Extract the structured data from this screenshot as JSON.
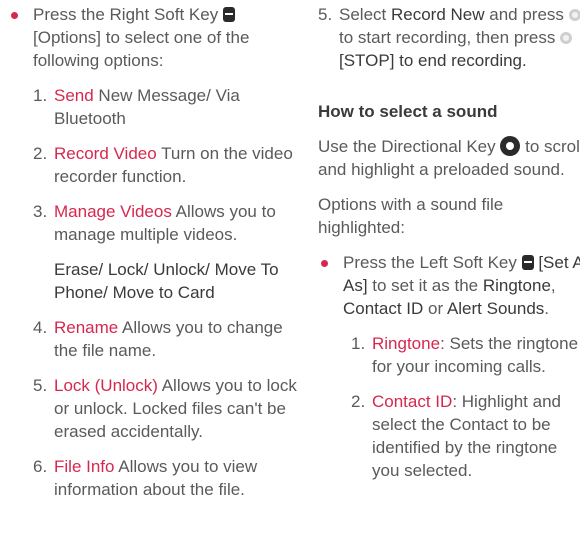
{
  "left": {
    "bullet": {
      "pre": "Press the Right Soft Key ",
      "post": "[Options] to select one of the following options:"
    },
    "items": [
      {
        "num": "1.",
        "title": "Send",
        "desc": " New Message/ Via Bluetooth"
      },
      {
        "num": "2.",
        "title": "Record Video",
        "desc": " Turn on the video recorder function."
      },
      {
        "num": "3.",
        "title": "Manage Videos",
        "desc": " Allows you to manage multiple videos."
      },
      {
        "num": "4.",
        "title": "Rename",
        "desc": " Allows you to change the file name."
      },
      {
        "num": "5.",
        "title": "Lock (Unlock)",
        "desc": " Allows you to lock or unlock. Locked files can't be erased accidentally."
      },
      {
        "num": "6.",
        "title": "File Info",
        "desc": " Allows you to view information about the file."
      }
    ],
    "manage_sub": "Erase/ Lock/ Unlock/ Move To Phone/ Move to Card"
  },
  "right": {
    "step5": {
      "num": "5.",
      "pre": "Select ",
      "bold": "Record New",
      "mid1": " and press ",
      "mid2": " to start recording, then press ",
      "post": " [STOP] to end recording."
    },
    "heading": "How to select a sound",
    "para1_pre": "Use the Directional Key ",
    "para1_post": " to scroll and highlight a preloaded sound.",
    "para2": "Options with a sound file highlighted:",
    "bullet": {
      "pre": "Press the Left Soft Key ",
      "seas": " [Set As]",
      "mid": " to set it as the ",
      "ringtone": "Ringtone",
      "comma": ",",
      "contact": "Contact ID",
      "or": " or ",
      "alert": "Alert Sounds",
      "end": "."
    },
    "items": [
      {
        "num": "1.",
        "title": "Ringtone",
        "desc": ": Sets the ringtone for your incoming calls."
      },
      {
        "num": "2.",
        "title": "Contact ID",
        "desc": ": Highlight and select the Contact to be identified by the ringtone you selected."
      }
    ]
  },
  "colors": {
    "accent": "#d6284e",
    "text": "#5a5a5a",
    "dark": "#3a3a3a"
  },
  "icons": {
    "soft_key": "soft-key-icon",
    "ok_key": "ok-key-icon",
    "directional_key": "directional-key-icon"
  }
}
